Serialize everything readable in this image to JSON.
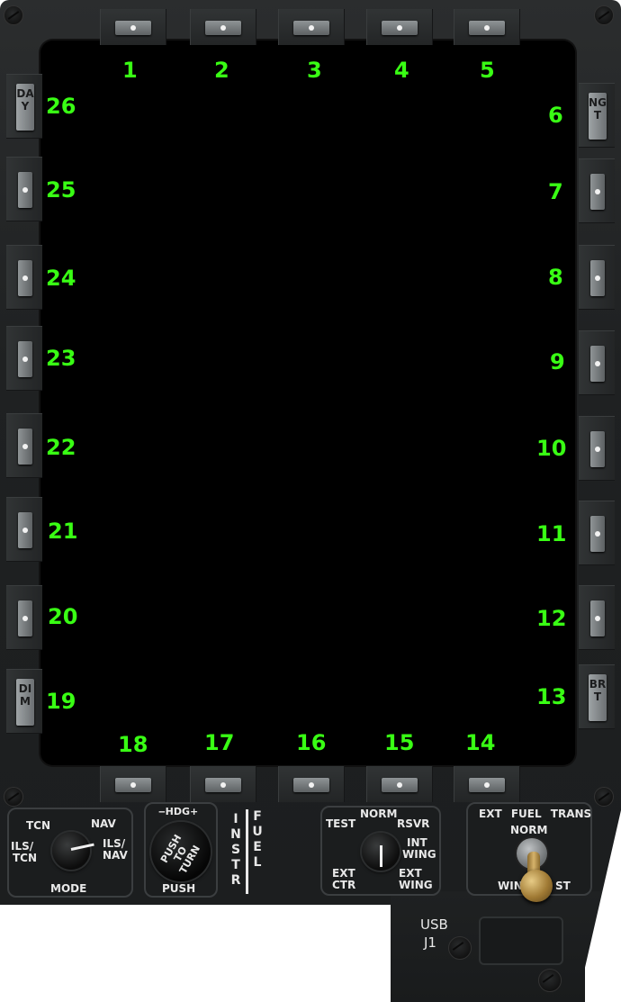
{
  "osb_labels": {
    "b1": "1",
    "b2": "2",
    "b3": "3",
    "b4": "4",
    "b5": "5",
    "b6": "6",
    "b7": "7",
    "b8": "8",
    "b9": "9",
    "b10": "10",
    "b11": "11",
    "b12": "12",
    "b13": "13",
    "b14": "14",
    "b15": "15",
    "b16": "16",
    "b17": "17",
    "b18": "18",
    "b19": "19",
    "b20": "20",
    "b21": "21",
    "b22": "22",
    "b23": "23",
    "b24": "24",
    "b25": "25",
    "b26": "26"
  },
  "rocker_caps": {
    "day": "DAY",
    "night": "NGT",
    "dim": "DIM",
    "bright": "BRT"
  },
  "mode_panel": {
    "tcn": "TCN",
    "nav": "NAV",
    "ils_tcn_1": "ILS/",
    "ils_tcn_2": "TCN",
    "ils_nav_1": "ILS/",
    "ils_nav_2": "NAV",
    "mode": "MODE"
  },
  "hdg_panel": {
    "hdg": "HDG",
    "knob_1": "PUSH",
    "knob_2": "TO",
    "knob_3": "TURN",
    "push": "PUSH"
  },
  "instr_fuel": {
    "instr": "INSTR",
    "fuel": "FUEL"
  },
  "fuel_selector": {
    "test": "TEST",
    "norm": "NORM",
    "rsvr": "RSVR",
    "int_wing_1": "INT",
    "int_wing_2": "WING",
    "ext_ctr_1": "EXT",
    "ext_ctr_2": "CTR",
    "ext_wing_1": "EXT",
    "ext_wing_2": "WING"
  },
  "ext_fuel_trans": {
    "title": "EXT FUEL TRANS",
    "norm": "NORM",
    "wing_partial": "WIN",
    "right_partial": "ST"
  },
  "usb": {
    "usb": "USB",
    "j1": "J1"
  },
  "colors": {
    "label_green": "#39ff14",
    "screen": "#000000",
    "bezel": "#1f2122"
  }
}
